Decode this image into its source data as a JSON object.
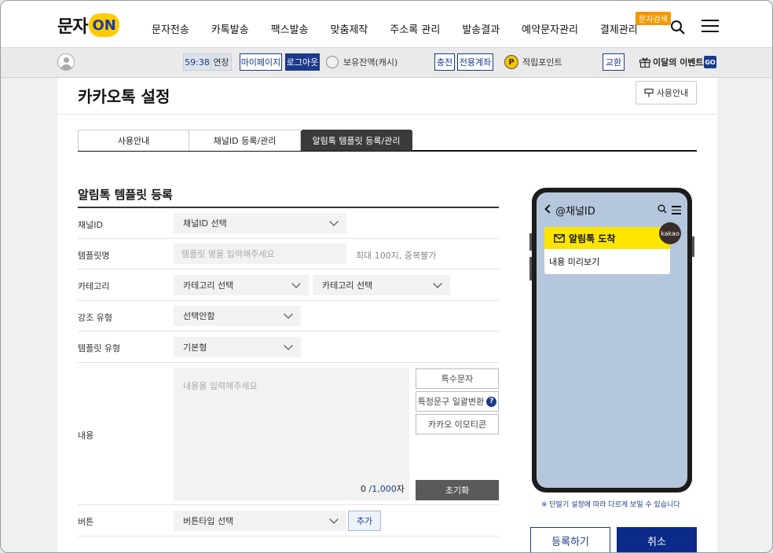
{
  "header": {
    "logo_text": "문자",
    "logo_on": "ON",
    "menu": [
      "문자전송",
      "카톡발송",
      "팩스발송",
      "맞춤제작",
      "주소록 관리",
      "발송결과",
      "예약문자관리",
      "결제관리"
    ],
    "search_badge": "문자검색"
  },
  "subbar": {
    "timer": "59:38",
    "extend": "연장",
    "mypage": "마이페이지",
    "logout": "로그아웃",
    "balance": "보유잔액(캐시)",
    "charge": "충전",
    "account": "전용계좌",
    "points": "적립포인트",
    "exchange": "교환",
    "event": "이달의 이벤트",
    "go": "GO"
  },
  "page": {
    "title": "카카오톡 설정",
    "guide_button": "사용안내",
    "tabs": [
      {
        "label": "사용안내",
        "active": false
      },
      {
        "label": "채널ID 등록/관리",
        "active": false
      },
      {
        "label": "알림톡 템플릿 등록/관리",
        "active": true
      }
    ]
  },
  "form": {
    "section_title": "알림톡 템플릿 등록",
    "channel": {
      "label": "채널ID",
      "value": "채널ID 선택"
    },
    "template_name": {
      "label": "템플릿명",
      "placeholder": "템플릿 명을 입력해주세요",
      "hint": "최대 100지, 중복불가"
    },
    "category": {
      "label": "카테고리",
      "value1": "카테고리 선택",
      "value2": "카테고리 선택"
    },
    "emphasis": {
      "label": "강조 유형",
      "value": "선택안함"
    },
    "template_type": {
      "label": "템플릿 유형",
      "value": "기본형"
    },
    "content": {
      "label": "내용",
      "placeholder": "내용을 입력해주세요",
      "count": "0",
      "max": "/1,000",
      "unit": "자",
      "special_chars": "특수문자",
      "bulk_replace": "특정문구 일괄변환",
      "emoticon": "카카오 이모티콘",
      "reset": "초기화"
    },
    "button": {
      "label": "버튼",
      "value": "버튼타입 선택",
      "add": "추가"
    }
  },
  "preview": {
    "channel": "@채널ID",
    "bubble_title": "알림톡 도착",
    "bubble_body": "내용 미리보기",
    "badge": "kakao",
    "note": "※ 단말기 설정에 따라 다르게 보일 수 있습니다"
  },
  "actions": {
    "register": "등록하기",
    "cancel": "취소"
  }
}
